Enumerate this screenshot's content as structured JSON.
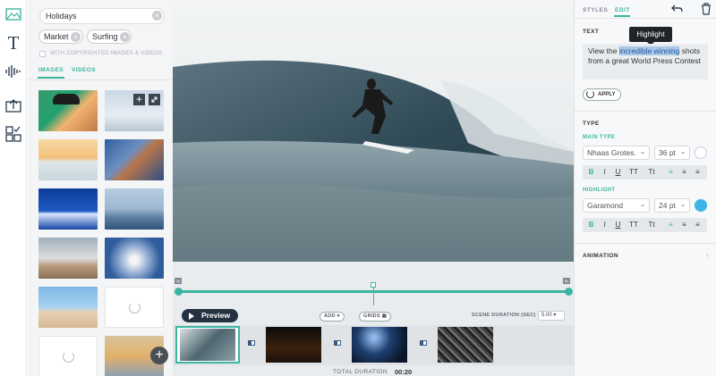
{
  "search": {
    "value": "Holidays"
  },
  "filters": {
    "tags": [
      "Market",
      "Surfing"
    ],
    "copyright_label": "WITH COPYRIGHTED IMAGES & VIDEOS"
  },
  "media_tabs": [
    "IMAGES",
    "VIDEOS"
  ],
  "editor_tabs": {
    "styles": "STYLES",
    "edit": "EDIT"
  },
  "text_section": {
    "label": "TEXT",
    "tooltip": "Highlight",
    "before": "View the ",
    "highlight": "incredible winning",
    "after": " shots from a great World Press Contest",
    "apply": "APPLY"
  },
  "type_section": {
    "label": "TYPE",
    "main_label": "MAIN TYPE",
    "main_font": "Nhaas Grotes.",
    "main_size": "36 pt",
    "highlight_label": "HIGHLIGHT",
    "highlight_font": "Garamond",
    "highlight_size": "24 pt",
    "highlight_color": "#3db5e6",
    "format_buttons": [
      "B",
      "I",
      "U",
      "TT",
      "Tt"
    ]
  },
  "animation": {
    "label": "ANIMATION"
  },
  "timeline": {
    "start_marker": "0s",
    "end_marker": "5s",
    "preview": "Preview",
    "add": "ADD",
    "grids": "GRIDS",
    "scene_duration_label": "SCENE DURATION (SEC)",
    "scene_duration_value": "5.00",
    "total_label": "TOTAL DURATION",
    "total_value": "00:20"
  },
  "colors": {
    "accent": "#3bb59f",
    "dark": "#2c3e50"
  }
}
